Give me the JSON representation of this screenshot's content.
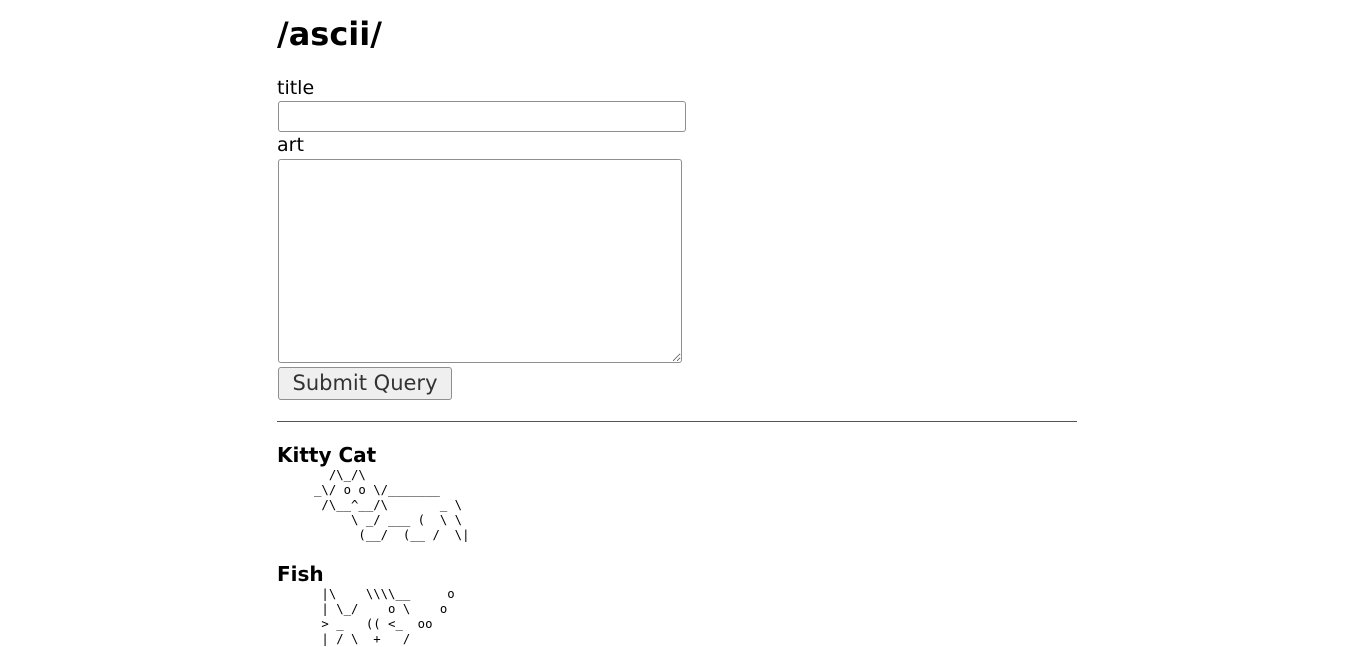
{
  "header": {
    "title": "/ascii/"
  },
  "form": {
    "title_label": "title",
    "title_value": "",
    "art_label": "art",
    "art_value": "",
    "submit_label": "Submit Query"
  },
  "arts": [
    {
      "title": "Kitty Cat",
      "art": "       /\\_/\\\n     _\\/ o o \\/_______\n      /\\__^__/\\       _ \\\n          \\ _/ ___ (  \\ \\\n           (__/  (__ /  \\|"
    },
    {
      "title": "Fish",
      "art": "      |\\    \\\\\\\\__     o\n      | \\_/    o \\    o\n      > _   (( <_  oo\n      | / \\  +   /"
    }
  ]
}
